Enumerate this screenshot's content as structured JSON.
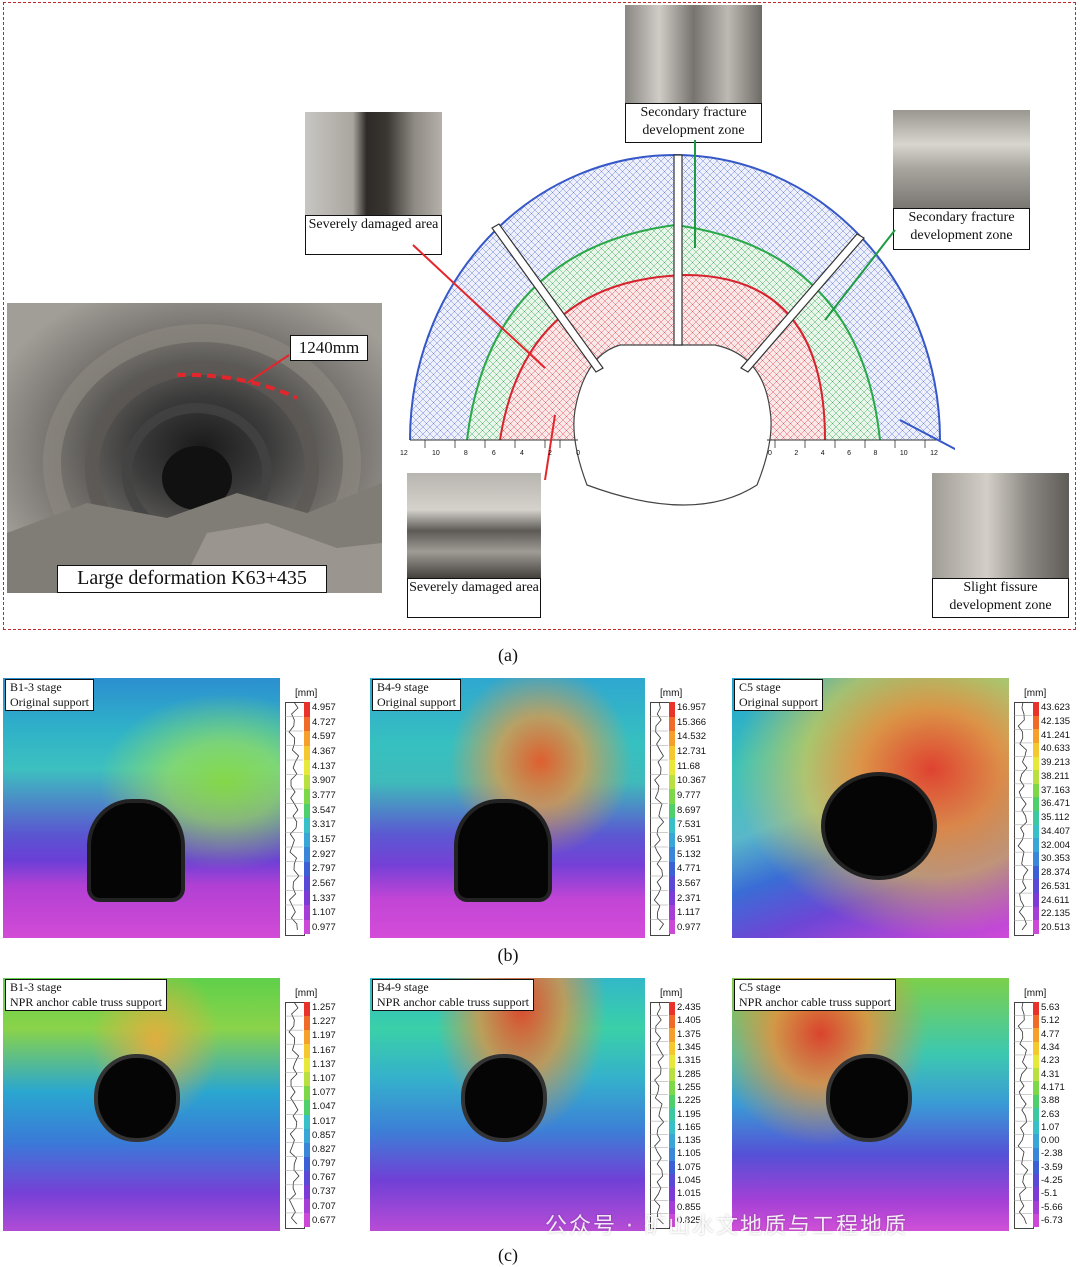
{
  "panel_a": {
    "label": "(a)",
    "photo_caption": "Large deformation K63+435",
    "deformation_value": "1240mm",
    "zones": {
      "severe_top": "Severely damaged area",
      "severe_bottom": "Severely damaged area",
      "secondary_top": "Secondary fracture development zone",
      "secondary_right": "Secondary fracture development zone",
      "slight": "Slight fissure development zone"
    },
    "scale_left": [
      "12",
      "10",
      "8",
      "6",
      "4",
      "2",
      "0"
    ],
    "scale_right": [
      "0",
      "2",
      "4",
      "6",
      "8",
      "10",
      "12"
    ],
    "colors": {
      "outer": "#3557c7",
      "middle": "#2aa84a",
      "inner": "#d6232e"
    }
  },
  "panel_b": {
    "label": "(b)",
    "unit": "[mm]",
    "panels": [
      {
        "stage": "B1-3 stage",
        "support": "Original support",
        "ticks": [
          "4.957",
          "4.727",
          "4.597",
          "4.367",
          "4.137",
          "3.907",
          "3.777",
          "3.547",
          "3.317",
          "3.157",
          "2.927",
          "2.797",
          "2.567",
          "1.337",
          "1.107",
          "0.977"
        ]
      },
      {
        "stage": "B4-9 stage",
        "support": "Original support",
        "ticks": [
          "16.957",
          "15.366",
          "14.532",
          "12.731",
          "11.68",
          "10.367",
          "9.777",
          "8.697",
          "7.531",
          "6.951",
          "5.132",
          "4.771",
          "3.567",
          "2.371",
          "1.117",
          "0.977"
        ]
      },
      {
        "stage": "C5 stage",
        "support": "Original support",
        "ticks": [
          "43.623",
          "42.135",
          "41.241",
          "40.633",
          "39.213",
          "38.211",
          "37.163",
          "36.471",
          "35.112",
          "34.407",
          "32.004",
          "30.353",
          "28.374",
          "26.531",
          "24.611",
          "22.135",
          "20.513"
        ]
      }
    ]
  },
  "panel_c": {
    "label": "(c)",
    "unit": "[mm]",
    "panels": [
      {
        "stage": "B1-3 stage",
        "support": "NPR anchor cable truss support",
        "ticks": [
          "1.257",
          "1.227",
          "1.197",
          "1.167",
          "1.137",
          "1.107",
          "1.077",
          "1.047",
          "1.017",
          "0.857",
          "0.827",
          "0.797",
          "0.767",
          "0.737",
          "0.707",
          "0.677"
        ]
      },
      {
        "stage": "B4-9 stage",
        "support": "NPR anchor cable truss support",
        "ticks": [
          "2.435",
          "1.405",
          "1.375",
          "1.345",
          "1.315",
          "1.285",
          "1.255",
          "1.225",
          "1.195",
          "1.165",
          "1.135",
          "1.105",
          "1.075",
          "1.045",
          "1.015",
          "0.855",
          "0.825"
        ]
      },
      {
        "stage": "C5 stage",
        "support": "NPR anchor cable truss support",
        "ticks": [
          "5.63",
          "5.12",
          "4.77",
          "4.34",
          "4.23",
          "4.31",
          "4.171",
          "3.88",
          "2.63",
          "1.07",
          "0.00",
          "-2.38",
          "-3.59",
          "-4.25",
          "-5.1",
          "-5.66",
          "-6.73"
        ]
      }
    ]
  },
  "watermark": "公众号 · 矿山水文地质与工程地质"
}
